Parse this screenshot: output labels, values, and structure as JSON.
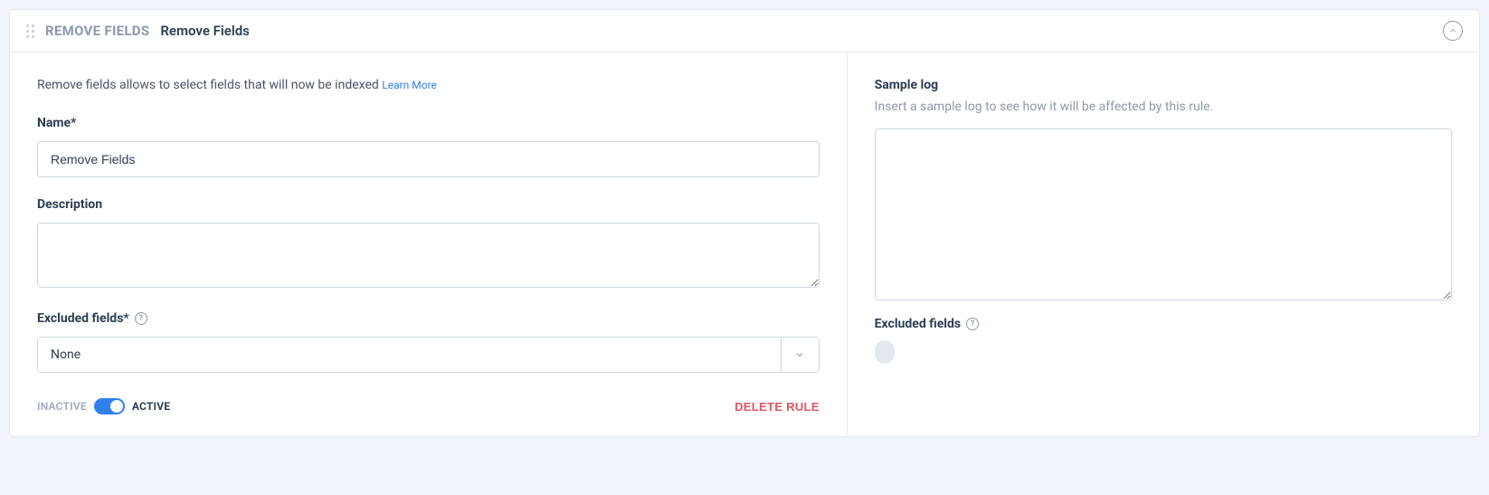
{
  "header": {
    "type_label": "REMOVE FIELDS",
    "title": "Remove Fields"
  },
  "left": {
    "intro_text": "Remove fields allows to select fields that will now be indexed",
    "learn_more": "Learn More",
    "name_label": "Name*",
    "name_value": "Remove Fields",
    "description_label": "Description",
    "description_value": "",
    "excluded_label": "Excluded fields*",
    "excluded_value": "None",
    "toggle": {
      "inactive": "INACTIVE",
      "active": "ACTIVE"
    },
    "delete_rule": "DELETE RULE"
  },
  "right": {
    "sample_title": "Sample log",
    "sample_desc": "Insert a sample log to see how it will be affected by this rule.",
    "sample_value": "",
    "excluded_title": "Excluded fields"
  }
}
